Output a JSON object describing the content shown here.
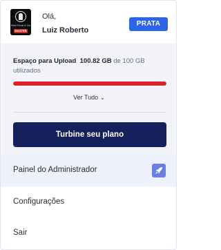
{
  "header": {
    "avatar_text": "Mais Ebook & Conhecimento",
    "avatar_badge": "MASTER",
    "greeting": "Olá,",
    "username": "Luiz Roberto",
    "plan_badge": "PRATA"
  },
  "storage": {
    "label": "Espaço para Upload",
    "used": "100.82 GB",
    "rest": "de 100 GB utilizados",
    "progress_fraction": 1.0,
    "see_all": "Ver Tudo",
    "cta": "Turbine seu plano"
  },
  "menu": {
    "admin": "Painel do Administrador",
    "config": "Configurações",
    "exit": "Sair"
  },
  "colors": {
    "accent_blue": "#2d64e8",
    "cta_navy": "#15215c",
    "progress_red": "#d9252a",
    "rocket_tile": "#6c7fe0"
  },
  "icons": {
    "avatar": "logo-avatar",
    "see_all": "chevron-down-icon",
    "admin": "rocket-icon"
  }
}
